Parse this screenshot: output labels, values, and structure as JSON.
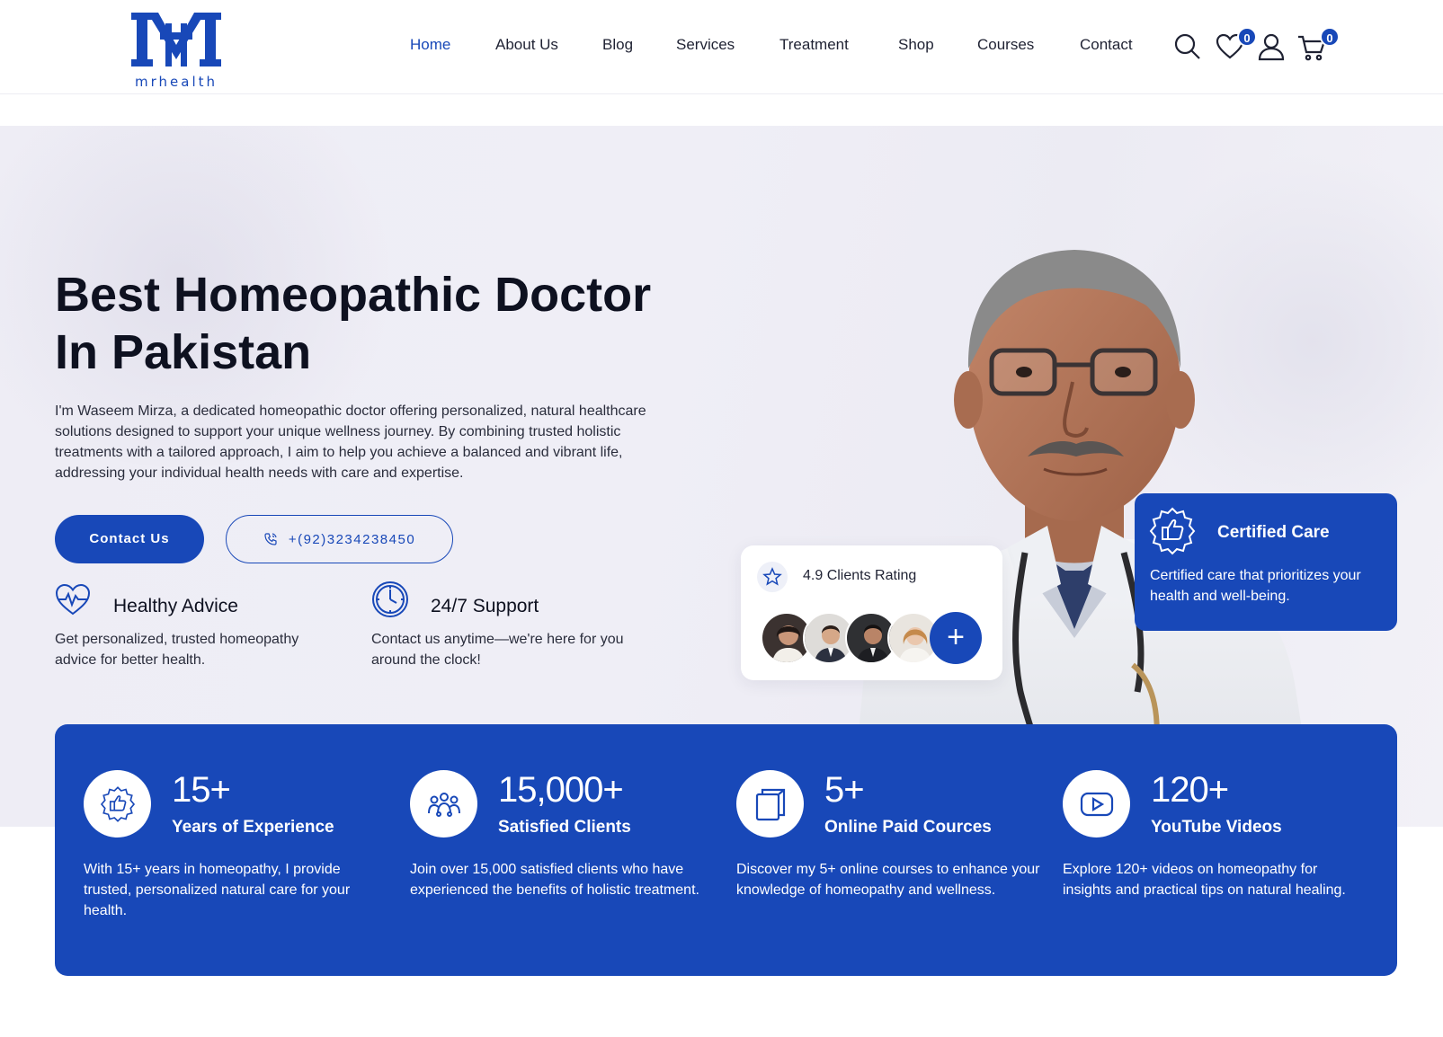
{
  "brand": {
    "logo_text": "mrhealth"
  },
  "nav": {
    "items": [
      "Home",
      "About Us",
      "Blog",
      "Services",
      "Treatment",
      "Shop",
      "Courses",
      "Contact"
    ],
    "active": "Home"
  },
  "header_icons": {
    "search": "search-icon",
    "wishlist": "heart-icon",
    "wishlist_count": "0",
    "account": "user-icon",
    "cart": "cart-icon",
    "cart_count": "0"
  },
  "hero": {
    "title_line1": "Best Homeopathic Doctor",
    "title_line2": "In Pakistan",
    "description": "I'm Waseem Mirza, a dedicated homeopathic doctor offering personalized, natural healthcare solutions designed to support your unique wellness journey. By combining trusted holistic treatments with a tailored approach, I aim to help you achieve a balanced and vibrant life, addressing your individual health needs with care and expertise.",
    "contact_button": "Contact Us",
    "phone": "+(92)3234238450",
    "features": [
      {
        "icon": "heartbeat-icon",
        "title": "Healthy Advice",
        "text": "Get personalized, trusted homeopathy advice for better health."
      },
      {
        "icon": "clock-icon",
        "title": "24/7 Support",
        "text": "Contact us anytime—we're here for you around the clock!"
      }
    ]
  },
  "rating_card": {
    "text": "4.9 Clients Rating",
    "plus": "+"
  },
  "cert_card": {
    "title": "Certified Care",
    "text": "Certified care that prioritizes your health and well-being."
  },
  "stats": [
    {
      "icon": "certified-badge-icon",
      "number": "15+",
      "label": "Years of Experience",
      "text": "With 15+ years in homeopathy, I provide trusted, personalized natural care for your health."
    },
    {
      "icon": "clients-icon",
      "number": "15,000+",
      "label": "Satisfied Clients",
      "text": "Join over 15,000 satisfied clients who have experienced the benefits of holistic treatment."
    },
    {
      "icon": "book-icon",
      "number": "5+",
      "label": "Online Paid Cources",
      "text": " Discover my 5+ online courses to enhance your knowledge of homeopathy and wellness."
    },
    {
      "icon": "youtube-icon",
      "number": "120+",
      "label": "YouTube Videos",
      "text": "Explore 120+ videos on homeopathy for insights and practical tips on natural healing."
    }
  ],
  "colors": {
    "brand_blue": "#1848b8",
    "hero_bg": "#eeedf5",
    "text_dark": "#0e1120"
  }
}
